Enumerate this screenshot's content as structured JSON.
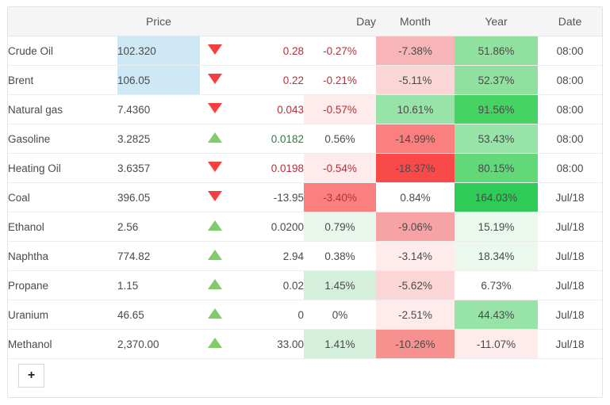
{
  "table": {
    "headers": {
      "name": "",
      "price": "Price",
      "arrow": "",
      "change": "",
      "day": "Day",
      "month": "Month",
      "year": "Year",
      "date": "Date"
    },
    "rows": [
      {
        "name": "Crude Oil",
        "price": "102.320",
        "price_highlight": "#cfe8f5",
        "direction": "down",
        "direction_icon": "triangle-down-icon",
        "change": "0.28",
        "change_sign": "neg",
        "day": "-0.27%",
        "day_bg": "",
        "day_sign": "neg",
        "month": "-7.38%",
        "month_bg": "#f7b5b8",
        "month_sign": "neg",
        "year": "51.86%",
        "year_bg": "#90e0a0",
        "year_sign": "pos",
        "date": "08:00"
      },
      {
        "name": "Brent",
        "price": "106.05",
        "price_highlight": "#cfe8f5",
        "direction": "down",
        "direction_icon": "triangle-down-icon",
        "change": "0.22",
        "change_sign": "neg",
        "day": "-0.21%",
        "day_bg": "",
        "day_sign": "neg",
        "month": "-5.11%",
        "month_bg": "#fbd6d6",
        "month_sign": "neg",
        "year": "52.37%",
        "year_bg": "#90e0a0",
        "year_sign": "pos",
        "date": "08:00"
      },
      {
        "name": "Natural gas",
        "price": "7.4360",
        "price_highlight": "",
        "direction": "down",
        "direction_icon": "triangle-down-icon",
        "change": "0.043",
        "change_sign": "neg",
        "day": "-0.57%",
        "day_bg": "#fdeceb",
        "day_sign": "neg",
        "month": "10.61%",
        "month_bg": "#98e4a8",
        "month_sign": "pos",
        "year": "91.56%",
        "year_bg": "#46d364",
        "year_sign": "pos",
        "date": "08:00"
      },
      {
        "name": "Gasoline",
        "price": "3.2825",
        "price_highlight": "",
        "direction": "up",
        "direction_icon": "triangle-up-icon",
        "change": "0.0182",
        "change_sign": "pos",
        "day": "0.56%",
        "day_bg": "",
        "day_sign": "pos",
        "month": "-14.99%",
        "month_bg": "#fa8080",
        "month_sign": "neg",
        "year": "53.43%",
        "year_bg": "#98e4a8",
        "year_sign": "pos",
        "date": "08:00"
      },
      {
        "name": "Heating Oil",
        "price": "3.6357",
        "price_highlight": "",
        "direction": "down",
        "direction_icon": "triangle-down-icon",
        "change": "0.0198",
        "change_sign": "neg",
        "day": "-0.54%",
        "day_bg": "#fdeceb",
        "day_sign": "neg",
        "month": "-18.37%",
        "month_bg": "#f94a4a",
        "month_sign": "neg",
        "year": "80.15%",
        "year_bg": "#62d979",
        "year_sign": "pos",
        "date": "08:00"
      },
      {
        "name": "Coal",
        "price": "396.05",
        "price_highlight": "",
        "direction": "down",
        "direction_icon": "triangle-down-icon",
        "change": "-13.95",
        "change_sign": "zero",
        "day": "-3.40%",
        "day_bg": "#fa8080",
        "day_sign": "neg",
        "month": "0.84%",
        "month_bg": "",
        "month_sign": "pos",
        "year": "164.03%",
        "year_bg": "#2ecc57",
        "year_sign": "pos",
        "date": "Jul/18"
      },
      {
        "name": "Ethanol",
        "price": "2.56",
        "price_highlight": "",
        "direction": "up",
        "direction_icon": "triangle-up-icon",
        "change": "0.0200",
        "change_sign": "zero",
        "day": "0.79%",
        "day_bg": "#e9f7ed",
        "day_sign": "pos",
        "month": "-9.06%",
        "month_bg": "#f7a2a4",
        "month_sign": "neg",
        "year": "15.19%",
        "year_bg": "#eaf8ee",
        "year_sign": "pos",
        "date": "Jul/18"
      },
      {
        "name": "Naphtha",
        "price": "774.82",
        "price_highlight": "",
        "direction": "up",
        "direction_icon": "triangle-up-icon",
        "change": "2.94",
        "change_sign": "zero",
        "day": "0.38%",
        "day_bg": "",
        "day_sign": "pos",
        "month": "-3.14%",
        "month_bg": "#fdeceb",
        "month_sign": "neg",
        "year": "18.34%",
        "year_bg": "#eaf8ee",
        "year_sign": "pos",
        "date": "Jul/18"
      },
      {
        "name": "Propane",
        "price": "1.15",
        "price_highlight": "",
        "direction": "up",
        "direction_icon": "triangle-up-icon",
        "change": "0.02",
        "change_sign": "zero",
        "day": "1.45%",
        "day_bg": "#d4f0dc",
        "day_sign": "pos",
        "month": "-5.62%",
        "month_bg": "#fbd6d6",
        "month_sign": "neg",
        "year": "6.73%",
        "year_bg": "",
        "year_sign": "pos",
        "date": "Jul/18"
      },
      {
        "name": "Uranium",
        "price": "46.65",
        "price_highlight": "",
        "direction": "up",
        "direction_icon": "triangle-up-icon",
        "change": "0",
        "change_sign": "zero",
        "day": "0%",
        "day_bg": "",
        "day_sign": "zero",
        "month": "-2.51%",
        "month_bg": "#fdeceb",
        "month_sign": "neg",
        "year": "44.43%",
        "year_bg": "#98e4a8",
        "year_sign": "pos",
        "date": "Jul/18"
      },
      {
        "name": "Methanol",
        "price": "2,370.00",
        "price_highlight": "",
        "direction": "up",
        "direction_icon": "triangle-up-icon",
        "change": "33.00",
        "change_sign": "zero",
        "day": "1.41%",
        "day_bg": "#d4f0dc",
        "day_sign": "pos",
        "month": "-10.26%",
        "month_bg": "#f7918f",
        "month_sign": "neg",
        "year": "-11.07%",
        "year_bg": "#fdeceb",
        "year_sign": "neg",
        "date": "Jul/18"
      }
    ]
  },
  "footer": {
    "add_button_label": "+",
    "add_button_icon": "plus-icon"
  },
  "colors": {
    "header_bg": "#f5f5f5",
    "price_highlight": "#cfe8f5",
    "positive_text": "#2f7a3d",
    "negative_text": "#b5303a",
    "arrow_up": "#82cb6a",
    "arrow_down": "#f4403f",
    "border": "#e3e3e3"
  }
}
